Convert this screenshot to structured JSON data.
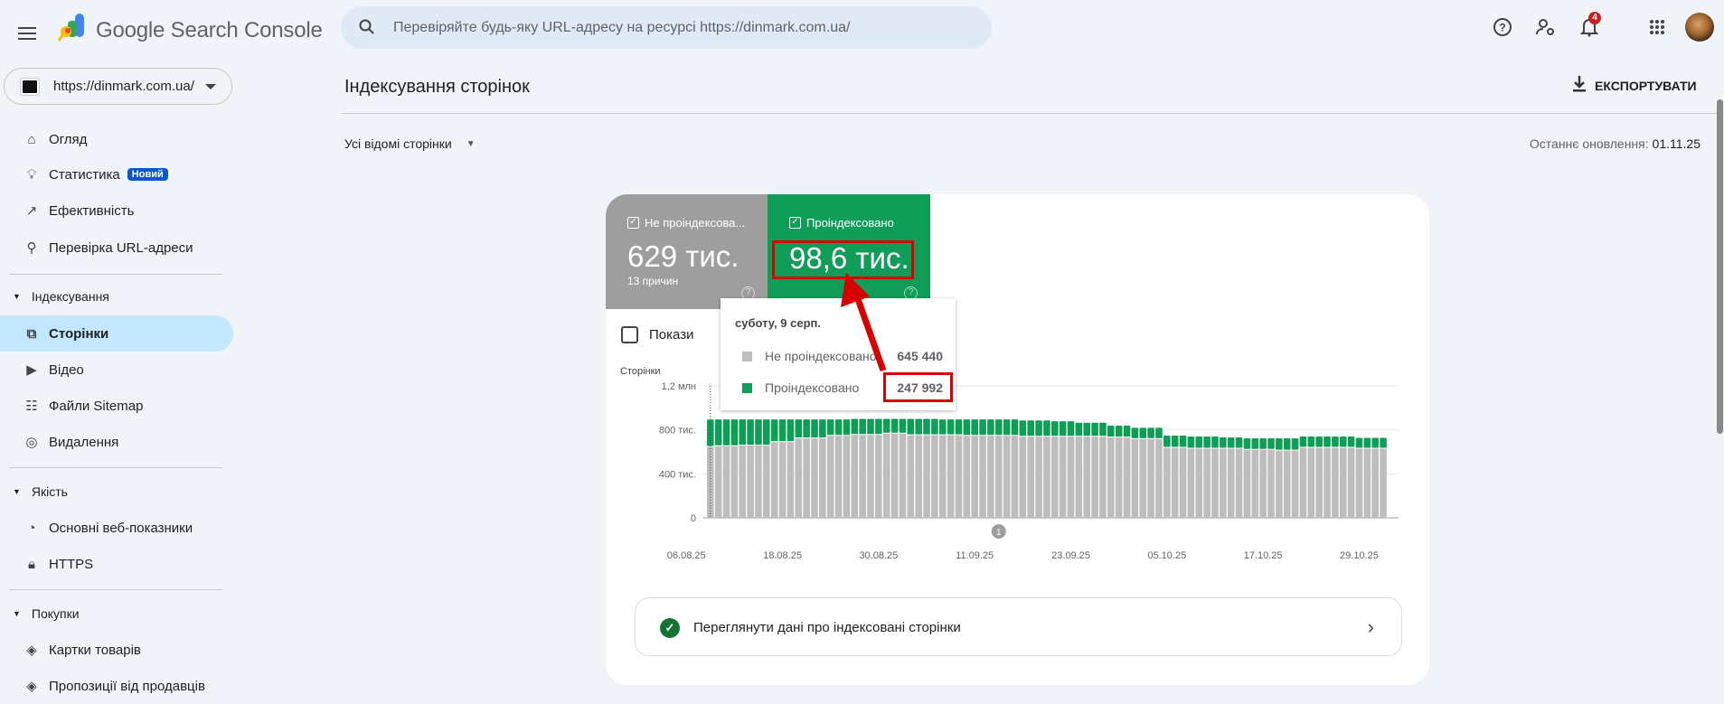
{
  "header": {
    "app_title": "Google Search Console",
    "search_placeholder": "Перевіряйте будь-яку URL-адресу на ресурсі https://dinmark.com.ua/",
    "notifications_count": "4"
  },
  "property": {
    "url": "https://dinmark.com.ua/"
  },
  "sidebar": {
    "top": [
      {
        "label": "Огляд"
      },
      {
        "label": "Статистика",
        "badge": "Новий"
      },
      {
        "label": "Ефективність"
      },
      {
        "label": "Перевірка URL-адреси"
      }
    ],
    "sections": [
      {
        "title": "Індексування",
        "items": [
          {
            "label": "Сторінки"
          },
          {
            "label": "Відео"
          },
          {
            "label": "Файли Sitemap"
          },
          {
            "label": "Видалення"
          }
        ]
      },
      {
        "title": "Якість",
        "items": [
          {
            "label": "Основні веб-показники"
          },
          {
            "label": "HTTPS"
          }
        ]
      },
      {
        "title": "Покупки",
        "items": [
          {
            "label": "Картки товарів"
          },
          {
            "label": "Пропозиції від продавців"
          }
        ]
      }
    ]
  },
  "main": {
    "title": "Індексування сторінок",
    "export_label": "ЕКСПОРТУВАТИ",
    "filter_label": "Усі відомі сторінки",
    "last_update_label": "Останнє оновлення:",
    "last_update_value": "01.11.25"
  },
  "tiles": [
    {
      "label": "Не проіндексова...",
      "value": "629 тис.",
      "sub": "13 причин",
      "color": "#9e9e9e"
    },
    {
      "label": "Проіндексовано",
      "value": "98,6 тис.",
      "color": "#0f9d58"
    }
  ],
  "impressions_label": "Покази",
  "tooltip": {
    "date": "суботу, 9 серп.",
    "rows": [
      {
        "label": "Не проіндексовано",
        "value": "645 440"
      },
      {
        "label": "Проіндексовано",
        "value": "247 992"
      }
    ]
  },
  "annotation_label": "1",
  "view_link_label": "Переглянути дані про індексовані сторінки",
  "chart_data": {
    "type": "bar",
    "stacked": true,
    "ylabel": "Сторінки",
    "y_unit": "thousands",
    "ylim": [
      0,
      1200
    ],
    "y_ticks": [
      {
        "value": 0,
        "label": "0"
      },
      {
        "value": 400,
        "label": "400 тис."
      },
      {
        "value": 800,
        "label": "800 тис."
      },
      {
        "value": 1200,
        "label": "1,2 млн"
      }
    ],
    "x_start": "09.08.25",
    "x_ticks": [
      {
        "day": -3,
        "label": "06.08.25"
      },
      {
        "day": 9,
        "label": "18.08.25"
      },
      {
        "day": 21,
        "label": "30.08.25"
      },
      {
        "day": 33,
        "label": "11.09.25"
      },
      {
        "day": 45,
        "label": "23.09.25"
      },
      {
        "day": 57,
        "label": "05.10.25"
      },
      {
        "day": 69,
        "label": "17.10.25"
      },
      {
        "day": 81,
        "label": "29.10.25"
      }
    ],
    "series": [
      {
        "name": "Не проіндексовано",
        "color": "#bdbdbd",
        "values": [
          645.4,
          651,
          651,
          651,
          657,
          657,
          657,
          657,
          689,
          689,
          689,
          722,
          722,
          722,
          722,
          746,
          746,
          746,
          754,
          754,
          754,
          754,
          765,
          765,
          765,
          751,
          751,
          751,
          751,
          751,
          751,
          751,
          746,
          746,
          746,
          746,
          746,
          746,
          746,
          738,
          738,
          738,
          738,
          738,
          738,
          738,
          738,
          738,
          738,
          738,
          730,
          730,
          730,
          716,
          716,
          716,
          716,
          637,
          637,
          637,
          629,
          629,
          629,
          629,
          629,
          629,
          629,
          619,
          619,
          619,
          619,
          611,
          611,
          611,
          637,
          637,
          637,
          637,
          637,
          637,
          637,
          629,
          629,
          629,
          629
        ]
      },
      {
        "name": "Проіндексовано",
        "color": "#0f9d58",
        "values": [
          248.0,
          244,
          244,
          244,
          238,
          238,
          238,
          238,
          206,
          206,
          206,
          173,
          173,
          173,
          173,
          149,
          149,
          149,
          146,
          146,
          146,
          146,
          135,
          135,
          135,
          149,
          149,
          149,
          149,
          144,
          144,
          144,
          149,
          149,
          149,
          149,
          149,
          149,
          149,
          148,
          148,
          148,
          148,
          140,
          140,
          140,
          127,
          127,
          127,
          127,
          108,
          108,
          108,
          103,
          103,
          103,
          103,
          111,
          111,
          111,
          111,
          111,
          111,
          111,
          103,
          103,
          103,
          104,
          104,
          104,
          104,
          112,
          112,
          112,
          103,
          103,
          103,
          103,
          103,
          103,
          103,
          98.6,
          98.6,
          98.6,
          98.6
        ]
      }
    ],
    "selected_index": 0,
    "annotations": [
      {
        "day": 36,
        "label": "1"
      }
    ]
  }
}
